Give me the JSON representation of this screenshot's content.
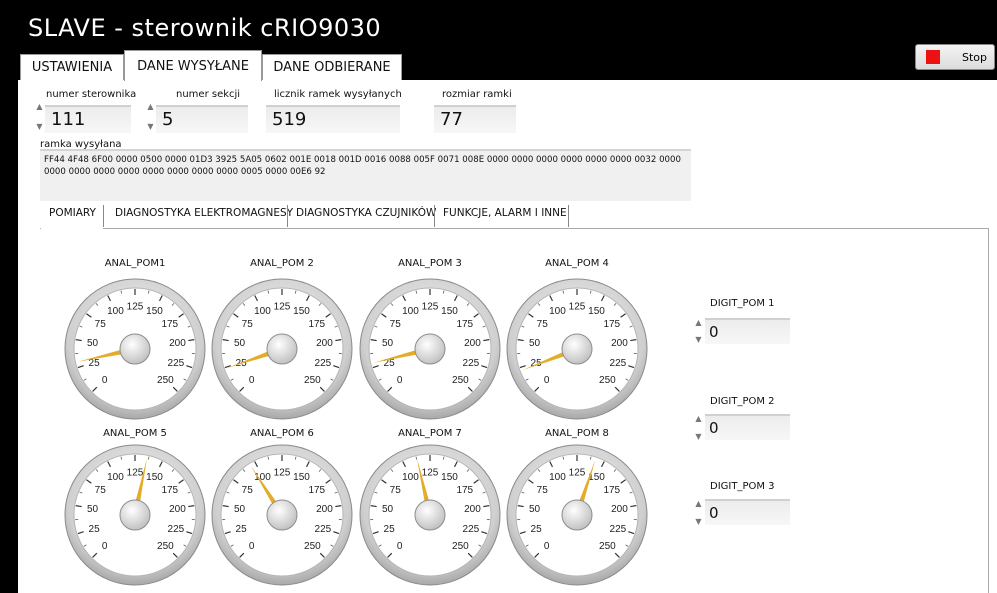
{
  "window": {
    "title": "SLAVE - sterownik cRIO9030"
  },
  "stop_button": {
    "label": "Stop"
  },
  "tabs": [
    {
      "label": "USTAWIENIA",
      "active": false
    },
    {
      "label": "DANE WYSYŁANE",
      "active": true
    },
    {
      "label": "DANE ODBIERANE",
      "active": false
    }
  ],
  "controls": {
    "numer_sterownika": {
      "label": "numer sterownika",
      "value": "111"
    },
    "numer_sekcji": {
      "label": "numer sekcji",
      "value": "5"
    },
    "licznik_ramek": {
      "label": "licznik ramek wysyłanych",
      "value": "519"
    },
    "rozmiar_ramki": {
      "label": "rozmiar ramki",
      "value": "77"
    }
  },
  "frame": {
    "label": "ramka wysyłana",
    "line1": "FF44 4F48 6F00 0000 0500 0000 01D3 3925 5A05 0602 001E 0018 001D 0016 0088 005F 0071 008E 0000 0000 0000 0000 0000 0000 0032 0000",
    "line2": "0000 0000 0000 0000 0000 0000 0000 0000 0005 0000 00E6 92"
  },
  "subtabs": [
    {
      "label": "POMIARY",
      "active": true
    },
    {
      "label": "DIAGNOSTYKA ELEKTROMAGNESY",
      "active": false
    },
    {
      "label": "DIAGNOSTYKA CZUJNIKÓW",
      "active": false
    },
    {
      "label": "FUNKCJE, ALARM I INNE",
      "active": false
    }
  ],
  "gauge_scale": {
    "min": 0,
    "max": 250,
    "ticks": [
      "0",
      "25",
      "50",
      "75",
      "100",
      "125",
      "150",
      "175",
      "200",
      "225",
      "250"
    ]
  },
  "gauges": [
    {
      "label": "ANAL_POM1",
      "value": 30
    },
    {
      "label": "ANAL_POM 2",
      "value": 24
    },
    {
      "label": "ANAL_POM 3",
      "value": 29
    },
    {
      "label": "ANAL_POM 4",
      "value": 22
    },
    {
      "label": "ANAL_POM 5",
      "value": 136
    },
    {
      "label": "ANAL_POM 6",
      "value": 95
    },
    {
      "label": "ANAL_POM 7",
      "value": 113
    },
    {
      "label": "ANAL_POM 8",
      "value": 142
    }
  ],
  "digits": [
    {
      "label": "DIGIT_POM 1",
      "value": "0"
    },
    {
      "label": "DIGIT_POM 2",
      "value": "0"
    },
    {
      "label": "DIGIT_POM 3",
      "value": "0"
    }
  ],
  "colors": {
    "needle": "#e3ac2b",
    "stop": "#ee1111",
    "background": "#000000"
  }
}
